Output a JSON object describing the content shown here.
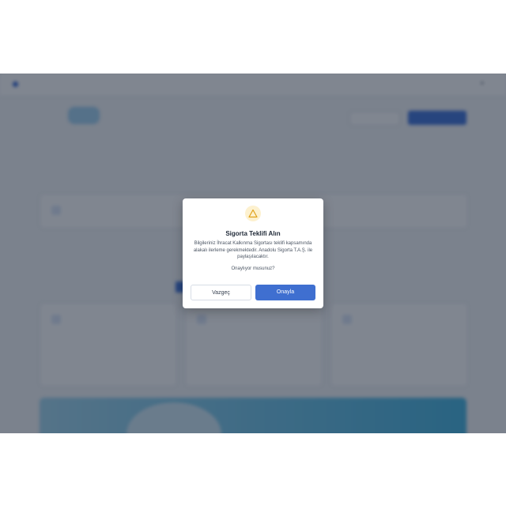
{
  "dialog": {
    "title": "Sigorta Teklifi Alın",
    "body": "Bilgileriniz İhracat Kalkınma Sigortası teklifi kapsamında alakalı ilerleme gerekmektedir. Anadolu Sigorta T.A.Ş. ile paylaşılacaktır.",
    "question": "Onaylıyor musunuz?",
    "cancel_label": "Vazgeç",
    "confirm_label": "Onayla",
    "icon": "warning-triangle-icon",
    "accent_color": "#3f6fd0",
    "warning_color": "#e0a21b"
  },
  "background": {
    "overlay_color": "rgba(24,34,52,0.55)"
  }
}
